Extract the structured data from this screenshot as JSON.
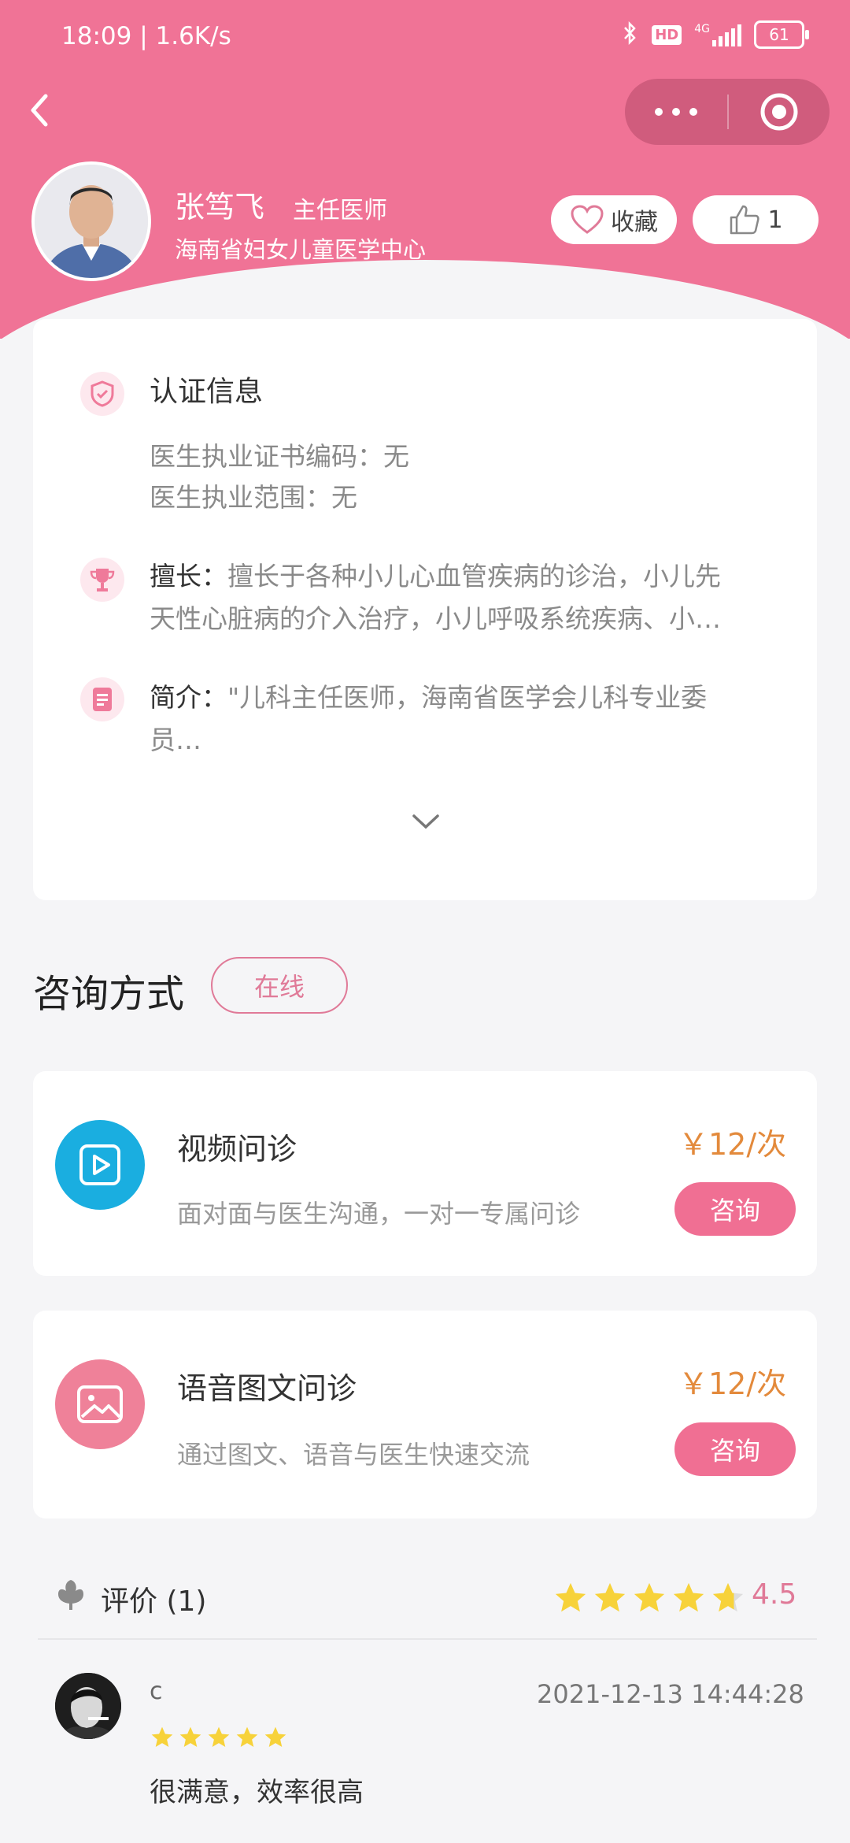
{
  "status_bar": {
    "time_speed": "18:09 | 1.6K/s",
    "hd": "HD",
    "network": "4G",
    "battery": "61"
  },
  "doctor": {
    "name": "张笃飞",
    "title": "主任医师",
    "hospital": "海南省妇女儿童医学中心",
    "favorite_label": "收藏",
    "like_count": "1"
  },
  "info": {
    "cert_title": "认证信息",
    "cert_line1": "医生执业证书编码：无",
    "cert_line2": "医生执业范围：无",
    "specialty_label": "擅长：",
    "specialty_line1": "擅长于各种小儿心血管疾病的诊治，小儿先",
    "specialty_line2": "天性心脏病的介入治疗，小儿呼吸系统疾病、小…",
    "intro_label": "简介：",
    "intro_line1": "\"儿科主任医师，海南省医学会儿科专业委",
    "intro_line2": "员…"
  },
  "consult": {
    "section_title": "咨询方式",
    "online_tag": "在线",
    "services": [
      {
        "name": "视频问诊",
        "desc": "面对面与医生沟通，一对一专属问诊",
        "price": "￥12/次",
        "button": "咨询",
        "icon": "video-play-icon",
        "color": "#1aaee0"
      },
      {
        "name": "语音图文问诊",
        "desc": "通过图文、语音与医生快速交流",
        "price": "￥12/次",
        "button": "咨询",
        "icon": "image-icon",
        "color": "#ef8199"
      }
    ]
  },
  "reviews": {
    "title": "评价 (1)",
    "rating": "4.5",
    "rating_value": 4.5,
    "items": [
      {
        "user": "c",
        "time": "2021-12-13 14:44:28",
        "stars": 5,
        "text": "很满意，效率很高"
      }
    ]
  },
  "colors": {
    "brand": "#f07396",
    "price": "#e38a3c",
    "star": "#f7d23a"
  }
}
